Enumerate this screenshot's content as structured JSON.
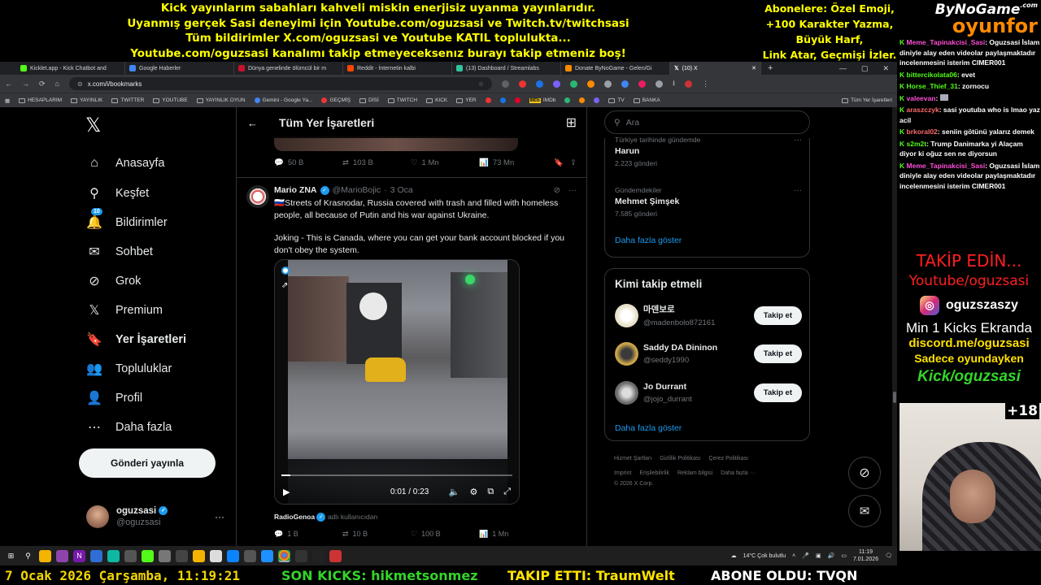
{
  "overlay": {
    "banner_lines": [
      "Kick yayınlarım sabahları kahveli miskin enerjisiz uyanma yayınlarıdır.",
      "Uyanmış gerçek Sasi deneyimi için Youtube.com/oguzsasi ve Twitch.tv/twitchsasi",
      "Tüm bildirimler X.com/oguzsasi ve Youtube KATIL toplulukta...",
      "Youtube.com/oguzsasi kanalımı takip etmeyeceksenız burayı takip etmeniz boş!"
    ],
    "subscriber_lines": [
      "Abonelere: Özel Emoji,",
      "+100 Karakter Yazma,",
      "Büyük Harf,",
      "Link Atar, Geçmişi İzler."
    ],
    "brand_top": "ByNoGame",
    "brand_com": ".com",
    "brand_bottom": "oyunfor",
    "chat": [
      {
        "user": "Meme_Tapinakcisi_Sasi",
        "text": ": Oguzsasi İslam diniyle alay eden videolar paylaşmaktadır incelenmesini isterim CIMER001"
      },
      {
        "user": "bittercikolata06",
        "text": ": evet"
      },
      {
        "user": "Horse_Thief_31",
        "text": ": zornocu"
      },
      {
        "user": "valeevan",
        "text": ":"
      },
      {
        "user": "araszczyk",
        "text": ": sasi youtuba who is lmao yaz acil"
      },
      {
        "user": "brkoral02",
        "text": ": seniin götünü yalarız demek"
      },
      {
        "user": "s2m2t",
        "text": ": Trump Danimarka yi Alaçam diyor ki oğuz sen ne diyorsun"
      },
      {
        "user": "Meme_Tapinakcisi_Sasi",
        "text": ": Oguzsasi İslam diniyle alay eden videolar paylaşmaktadır incelenmesini isterim CIMER001"
      }
    ],
    "takip": "TAKİP EDİN...",
    "youtube": "Youtube/oguzsasi",
    "instagram": "oguzszaszy",
    "min_kick": "Min 1 Kicks Ekranda",
    "discord": "discord.me/oguzsasi",
    "sadece": "Sadece oyundayken",
    "kick": "Kick/oguzsasi",
    "age": "+18",
    "ticker": {
      "date": "7 Ocak 2026 Çarşamba, 11:19:21",
      "kicks": "SON KICKS: hikmetsonmez",
      "follow": "TAKIP ETTI: TraumWelt",
      "sub": "ABONE OLDU: TVQN"
    }
  },
  "browser": {
    "tabs": [
      {
        "label": "Kicklet.app - Kick Chatbot and",
        "color": "#53fc18"
      },
      {
        "label": "Google Haberler",
        "color": "#4285f4"
      },
      {
        "label": "Dünya genelinde ölümcül bir m",
        "color": "#c8102e"
      },
      {
        "label": "Reddit - İnternetin kalbi",
        "color": "#ff4500"
      },
      {
        "label": "(13) Dashboard / Streamlabs",
        "color": "#31c3a2"
      },
      {
        "label": "Donate ByNoGame - Gelen/Gi",
        "color": "#ff8a00"
      },
      {
        "label": "(10) X",
        "color": "#ffffff"
      }
    ],
    "url": "x.com/i/bookmarks",
    "bookmarks": [
      "HESAPLARIM",
      "YAYINLIK",
      "TWITTER",
      "YOUTUBE",
      "YAYINLIK OYUN",
      "Gemini - Google Ya...",
      "GEÇMİŞ",
      "DİSİ",
      "TWITCH",
      "KICK",
      "YER",
      "IMDb",
      "TV",
      "BANKA"
    ],
    "all_bookmarks": "Tüm Yer İşaretleri"
  },
  "nav": {
    "items": [
      {
        "label": "Anasayfa",
        "icon": "home-icon",
        "glyph": "⌂"
      },
      {
        "label": "Keşfet",
        "icon": "search-icon",
        "glyph": "⚲"
      },
      {
        "label": "Bildirimler",
        "icon": "bell-icon",
        "glyph": "🔔"
      },
      {
        "label": "Sohbet",
        "icon": "mail-icon",
        "glyph": "✉"
      },
      {
        "label": "Grok",
        "icon": "grok-icon",
        "glyph": "⊘"
      },
      {
        "label": "Premium",
        "icon": "x-premium-icon",
        "glyph": "𝕏"
      },
      {
        "label": "Yer İşaretleri",
        "icon": "bookmark-icon",
        "glyph": "🔖"
      },
      {
        "label": "Topluluklar",
        "icon": "communities-icon",
        "glyph": "👥"
      },
      {
        "label": "Profil",
        "icon": "profile-icon",
        "glyph": "👤"
      },
      {
        "label": "Daha fazla",
        "icon": "more-icon",
        "glyph": "⋯"
      }
    ],
    "notif_count": "10",
    "post_button": "Gönderi yayınla",
    "profile_name": "oguzsasi",
    "profile_handle": "@oguzsasi"
  },
  "center": {
    "title": "Tüm Yer İşaretleri",
    "prev_actions": {
      "replies": "50 B",
      "reposts": "103 B",
      "likes": "1 Mn",
      "views": "73 Mn"
    },
    "tweet": {
      "name": "Mario ZNA",
      "handle": "@MarioBojic",
      "dot": "·",
      "date": "3 Oca",
      "text1": "🇷🇺Streets of Krasnodar, Russia covered with trash and filled with homeless people, all because of Putin and his war against Ukraine.",
      "text2": "Joking - This is Canada, where you can get your bank account blocked if you don't obey the system.",
      "video_time": "0:01 / 0:23",
      "video_progress": 0.04,
      "source_name": "RadioGenoa",
      "source_suffix": "adlı kullanıcıdan",
      "actions": {
        "replies": "1 B",
        "reposts": "10 B",
        "likes": "100 B",
        "views": "1 Mn"
      }
    }
  },
  "right": {
    "search_placeholder": "Ara",
    "trends": [
      {
        "ctx": "Türkiye tarihinde gündemde",
        "title": "Harun",
        "count": "2.223 gönderi"
      },
      {
        "ctx": "Gündemdekiler",
        "title": "Mehmet Şimşek",
        "count": "7.585 gönderi"
      }
    ],
    "show_more": "Daha fazla göster",
    "follow_title": "Kimi takip etmeli",
    "follow_users": [
      {
        "name": "마덴보로",
        "handle": "@madenbolo872161",
        "button": "Takip et",
        "color": "#e8e0c8"
      },
      {
        "name": "Saddy DA Dininon",
        "handle": "@seddy1990",
        "button": "Takip et",
        "color": "#c9a44a"
      },
      {
        "name": "Jo Durrant",
        "handle": "@jojo_durrant",
        "button": "Takip et",
        "color": "#6b6b6b"
      }
    ],
    "footer_links": [
      "Hizmet Şartları",
      "Gizlilik Politikası",
      "Çerez Politikası",
      "Imprint",
      "Erişilebilirlik",
      "Reklam bilgisi",
      "Daha fazla ···",
      "© 2026 X Corp."
    ]
  },
  "taskbar": {
    "weather": "14°C  Çok bulutlu",
    "time": "11:19",
    "date": "7.01.2026"
  }
}
